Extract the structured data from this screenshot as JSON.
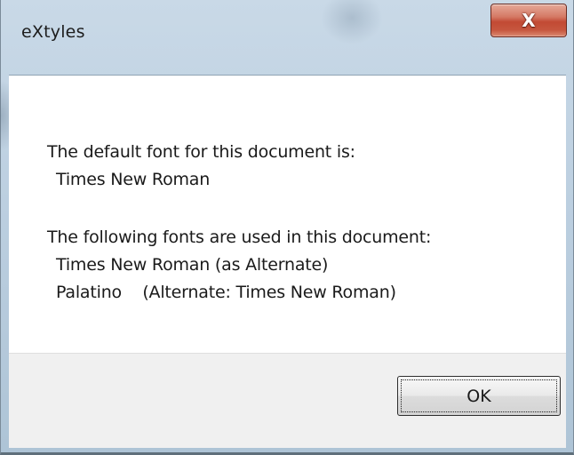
{
  "window": {
    "title": "eXtyles",
    "close_glyph": "X",
    "close_icon": "close-icon"
  },
  "message": {
    "default_font_heading": "The default font for this document is:",
    "default_font_value": "Times New Roman",
    "used_fonts_heading": "The following fonts are used in this document:",
    "used_fonts": [
      "Times New Roman (as Alternate)",
      "Palatino    (Alternate: Times New Roman)"
    ]
  },
  "buttons": {
    "ok_label": "OK"
  },
  "colors": {
    "close_button": "#c9523b",
    "content_background": "#ffffff",
    "footer_background": "#f0f0f0"
  }
}
